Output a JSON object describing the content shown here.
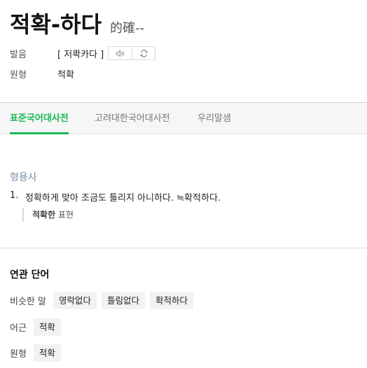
{
  "entry": {
    "word": "적확-하다",
    "hanja": "的確--"
  },
  "info": {
    "pron_label": "발음",
    "pron_value": "[ 저콱카다 ]",
    "icons": [
      "speaker-icon",
      "repeat-icon"
    ],
    "base_label": "원형",
    "base_value": "적확"
  },
  "tabs": [
    {
      "label": "표준국어대사전",
      "active": true
    },
    {
      "label": "고려대한국어대사전",
      "active": false
    },
    {
      "label": "우리말샘",
      "active": false
    }
  ],
  "definition": {
    "pos": "형용사",
    "number": "1.",
    "text": "정확하게 맞아 조금도 틀리지 아니하다. ≒확적하다.",
    "example_bold": "적확한",
    "example_rest": " 표현"
  },
  "related": {
    "title": "연관 단어",
    "rows": [
      {
        "label": "비슷한 말",
        "chips": [
          "영락없다",
          "틀림없다",
          "확적하다"
        ]
      },
      {
        "label": "어근",
        "chips": [
          "적확"
        ]
      },
      {
        "label": "원형",
        "chips": [
          "적확"
        ]
      }
    ]
  },
  "colors": {
    "accent": "#19b955",
    "pos": "#7a8ba8",
    "chip_bg": "#f1f2f4"
  }
}
